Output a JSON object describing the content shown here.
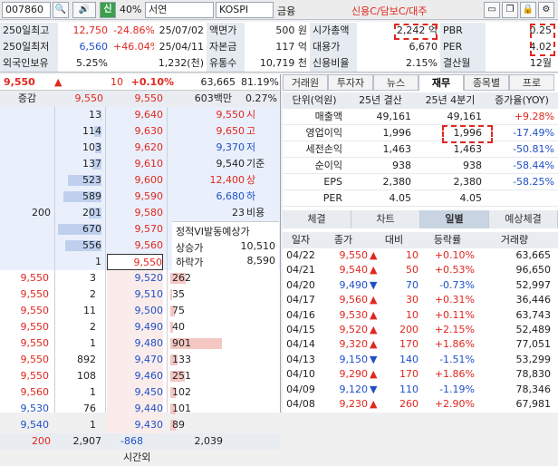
{
  "toolbar": {
    "code": "007860",
    "mode": "신",
    "zoom": "40%",
    "name": "서연",
    "market": "KOSPI",
    "sector": "금융",
    "credit": "신용C/담보C/대주"
  },
  "info": {
    "rows": [
      [
        "250일최고",
        "12,750",
        "-24.86%",
        "25/07/02",
        "액면가",
        "500 원",
        "시가총액",
        "2,242 억",
        "PBR",
        "0.25"
      ],
      [
        "250일최저",
        "6,560",
        "+46.04%",
        "25/04/11",
        "자본금",
        "117 억",
        "대용가",
        "6,670",
        "PER",
        "4.02"
      ],
      [
        "외국인보유",
        "5.25%",
        "",
        "1,232(천)",
        "유통수",
        "10,719 천",
        "신용비율",
        "2.15%",
        "결산월",
        "12월"
      ]
    ]
  },
  "quote": {
    "price": "9,550",
    "change": "10",
    "rate": "+0.10%",
    "volume": "63,665",
    "volrate": "81.19%",
    "col_head": "증감",
    "amount": "603백만",
    "amount_rate": "0.27%"
  },
  "asks": [
    {
      "diff": "",
      "qty": "13",
      "price": "9,640"
    },
    {
      "diff": "",
      "qty": "114",
      "price": "9,630"
    },
    {
      "diff": "",
      "qty": "103",
      "price": "9,620"
    },
    {
      "diff": "",
      "qty": "137",
      "price": "9,610"
    },
    {
      "diff": "",
      "qty": "523",
      "price": "9,600"
    },
    {
      "diff": "",
      "qty": "589",
      "price": "9,590"
    },
    {
      "diff": "200",
      "qty": "201",
      "price": "9,580"
    },
    {
      "diff": "",
      "qty": "670",
      "price": "9,570"
    },
    {
      "diff": "",
      "qty": "556",
      "price": "9,560"
    },
    {
      "diff": "",
      "qty": "1",
      "price": "9,550"
    }
  ],
  "side_stats": [
    {
      "val": "9,550",
      "lbl": "시"
    },
    {
      "val": "9,650",
      "lbl": "고"
    },
    {
      "val": "9,370",
      "lbl": "저"
    },
    {
      "val": "9,540",
      "lbl": "기준"
    },
    {
      "val": "12,400",
      "lbl": "상"
    },
    {
      "val": "6,680",
      "lbl": "하"
    },
    {
      "val": "23",
      "lbl": "비용"
    }
  ],
  "vi": {
    "title": "정적VI발동예상가",
    "up_label": "상승가",
    "up": "10,510",
    "down_label": "하락가",
    "down": "8,590"
  },
  "ticks": [
    {
      "price": "9,550",
      "qty": "3",
      "up": true
    },
    {
      "price": "9,550",
      "qty": "2",
      "up": true
    },
    {
      "price": "9,550",
      "qty": "11",
      "up": true
    },
    {
      "price": "9,550",
      "qty": "2",
      "up": true
    },
    {
      "price": "9,550",
      "qty": "1",
      "up": true
    },
    {
      "price": "9,550",
      "qty": "892",
      "up": true
    },
    {
      "price": "9,550",
      "qty": "108",
      "up": true
    },
    {
      "price": "9,560",
      "qty": "1",
      "up": true
    },
    {
      "price": "9,530",
      "qty": "76",
      "up": false
    },
    {
      "price": "9,540",
      "qty": "1",
      "up": false
    }
  ],
  "bids": [
    {
      "price": "9,520",
      "qty": "262"
    },
    {
      "price": "9,510",
      "qty": "35"
    },
    {
      "price": "9,500",
      "qty": "75"
    },
    {
      "price": "9,490",
      "qty": "40"
    },
    {
      "price": "9,480",
      "qty": "901"
    },
    {
      "price": "9,470",
      "qty": "133"
    },
    {
      "price": "9,460",
      "qty": "251"
    },
    {
      "price": "9,450",
      "qty": "102"
    },
    {
      "price": "9,440",
      "qty": "101"
    },
    {
      "price": "9,430",
      "qty": "89"
    }
  ],
  "totals": {
    "diff": "200",
    "ask": "2,907",
    "bid_diff": "-868",
    "bid": "2,039",
    "after": "시간외"
  },
  "tabs": [
    "거래원",
    "투자자",
    "뉴스",
    "재무",
    "종목별",
    "프로"
  ],
  "fin": {
    "head": [
      "단위(억원)",
      "25년 결산",
      "25년 4분기",
      "증가율(YOY)"
    ],
    "rows": [
      [
        "매출액",
        "49,161",
        "49,161",
        "+9.28%"
      ],
      [
        "영업이익",
        "1,996",
        "1,996",
        "-17.49%"
      ],
      [
        "세전손익",
        "1,463",
        "1,463",
        "-50.81%"
      ],
      [
        "순이익",
        "938",
        "938",
        "-58.44%"
      ],
      [
        "EPS",
        "2,380",
        "2,380",
        "-58.25%"
      ],
      [
        "PER",
        "4.05",
        "4.05",
        ""
      ]
    ]
  },
  "tabs2": [
    "체결",
    "차트",
    "일별",
    "예상체결"
  ],
  "daily": {
    "head": [
      "일자",
      "종가",
      "대비",
      "등락률",
      "거래량"
    ],
    "rows": [
      [
        "04/22",
        "9,550",
        "10",
        "+0.10%",
        "63,665",
        "u"
      ],
      [
        "04/21",
        "9,540",
        "50",
        "+0.53%",
        "96,650",
        "u"
      ],
      [
        "04/20",
        "9,490",
        "70",
        "-0.73%",
        "52,997",
        "d"
      ],
      [
        "04/17",
        "9,560",
        "30",
        "+0.31%",
        "36,446",
        "u"
      ],
      [
        "04/16",
        "9,530",
        "10",
        "+0.11%",
        "63,743",
        "u"
      ],
      [
        "04/15",
        "9,520",
        "200",
        "+2.15%",
        "52,489",
        "u"
      ],
      [
        "04/14",
        "9,320",
        "170",
        "+1.86%",
        "77,051",
        "u"
      ],
      [
        "04/13",
        "9,150",
        "140",
        "-1.51%",
        "53,299",
        "d"
      ],
      [
        "04/10",
        "9,290",
        "170",
        "+1.86%",
        "78,830",
        "u"
      ],
      [
        "04/09",
        "9,120",
        "110",
        "-1.19%",
        "78,346",
        "d"
      ],
      [
        "04/08",
        "9,230",
        "260",
        "+2.90%",
        "67,981",
        "u"
      ]
    ]
  }
}
